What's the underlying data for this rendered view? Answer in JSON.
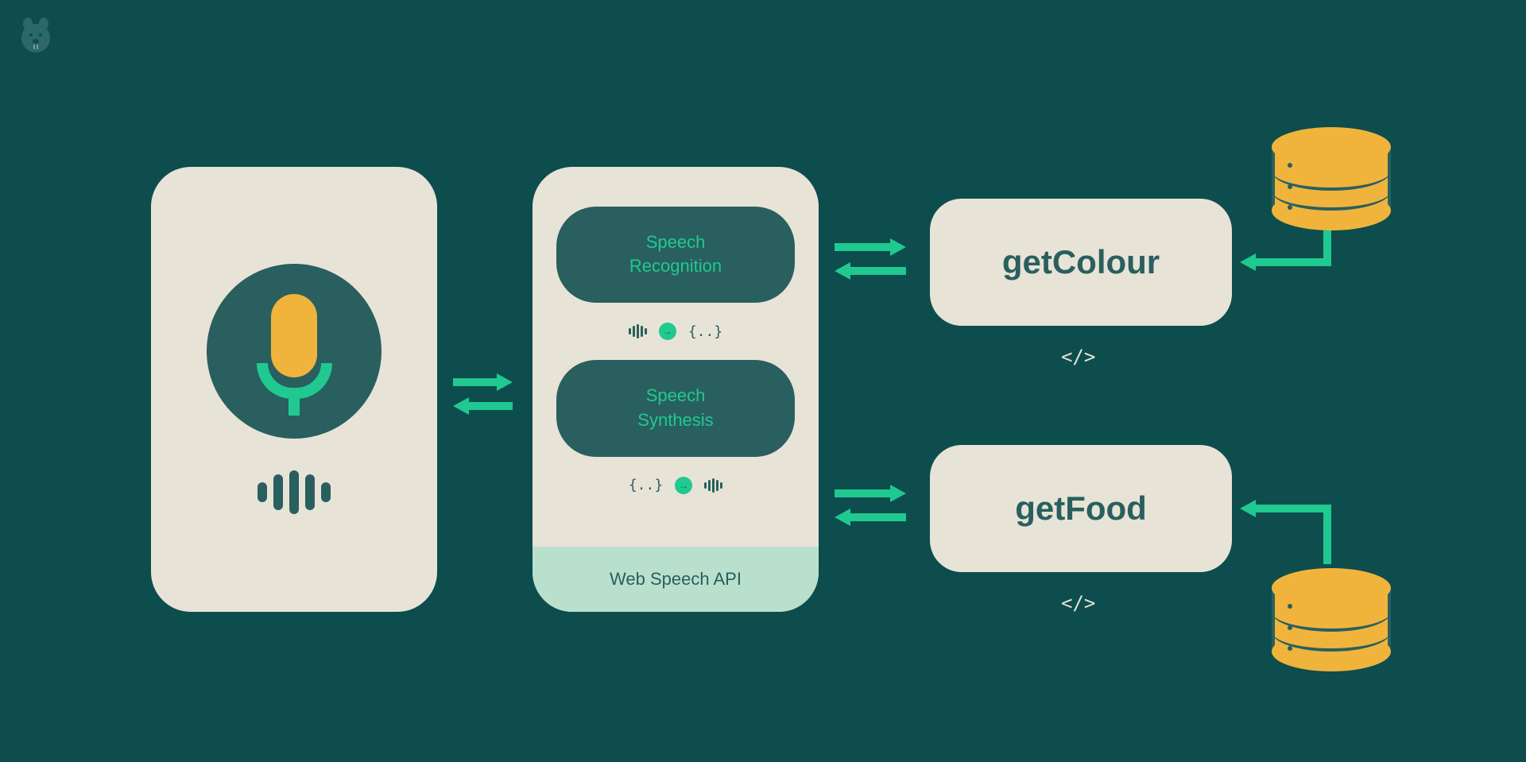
{
  "speech_api": {
    "recognition": "Speech\nRecognition",
    "recognition_line1": "Speech",
    "recognition_line2": "Recognition",
    "synthesis": "Speech\nSynthesis",
    "synthesis_line1": "Speech",
    "synthesis_line2": "Synthesis",
    "footer": "Web Speech API",
    "braces": "{..}"
  },
  "api": {
    "getColour": "getColour",
    "getFood": "getFood",
    "code_icon": "</>"
  }
}
